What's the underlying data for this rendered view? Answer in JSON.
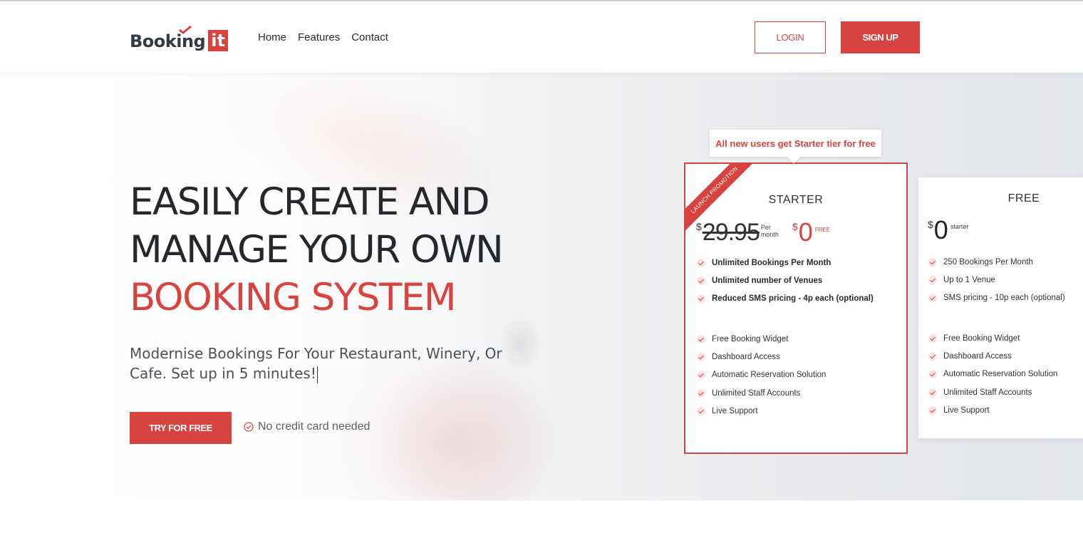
{
  "nav": {
    "logo_text": "Booking",
    "logo_badge": "it",
    "links": [
      "Home",
      "Features",
      "Contact"
    ],
    "login_label": "LOGIN",
    "signup_label": "SIGN UP"
  },
  "hero": {
    "headline_line1": "EASILY CREATE AND",
    "headline_line2": "MANAGE YOUR OWN",
    "headline_accent": "BOOKING SYSTEM",
    "subheadline": "Modernise Bookings For Your Restaurant, Winery, Or Cafe. Set up in 5 minutes!",
    "cta_label": "TRY FOR FREE",
    "no_card_text": "No credit card needed"
  },
  "pricing": {
    "promo_tooltip": "All new users get Starter tier for free",
    "starter": {
      "ribbon": "LAUNCH PROMOTION",
      "name": "STARTER",
      "currency": "$",
      "old_price": "29.95",
      "per_label": "Per month",
      "new_price": "0",
      "new_tag": "FREE",
      "features_main": [
        "Unlimited Bookings Per Month",
        "Unlimited number of Venues",
        "Reduced SMS pricing - 4p each (optional)"
      ],
      "features_extra": [
        "Free Booking Widget",
        "Dashboard Access",
        "Automatic Reservation Solution",
        "Unlimited Staff Accounts",
        "Live Support"
      ]
    },
    "free": {
      "name": "FREE",
      "currency": "$",
      "price": "0",
      "tag": "starter",
      "features_main": [
        "250 Bookings Per Month",
        "Up to 1 Venue",
        "SMS pricing - 10p each (optional)"
      ],
      "features_extra": [
        "Free Booking Widget",
        "Dashboard Access",
        "Automatic Reservation Solution",
        "Unlimited Staff Accounts",
        "Live Support"
      ]
    }
  },
  "colors": {
    "accent": "#d9433f",
    "text": "#24272b"
  }
}
